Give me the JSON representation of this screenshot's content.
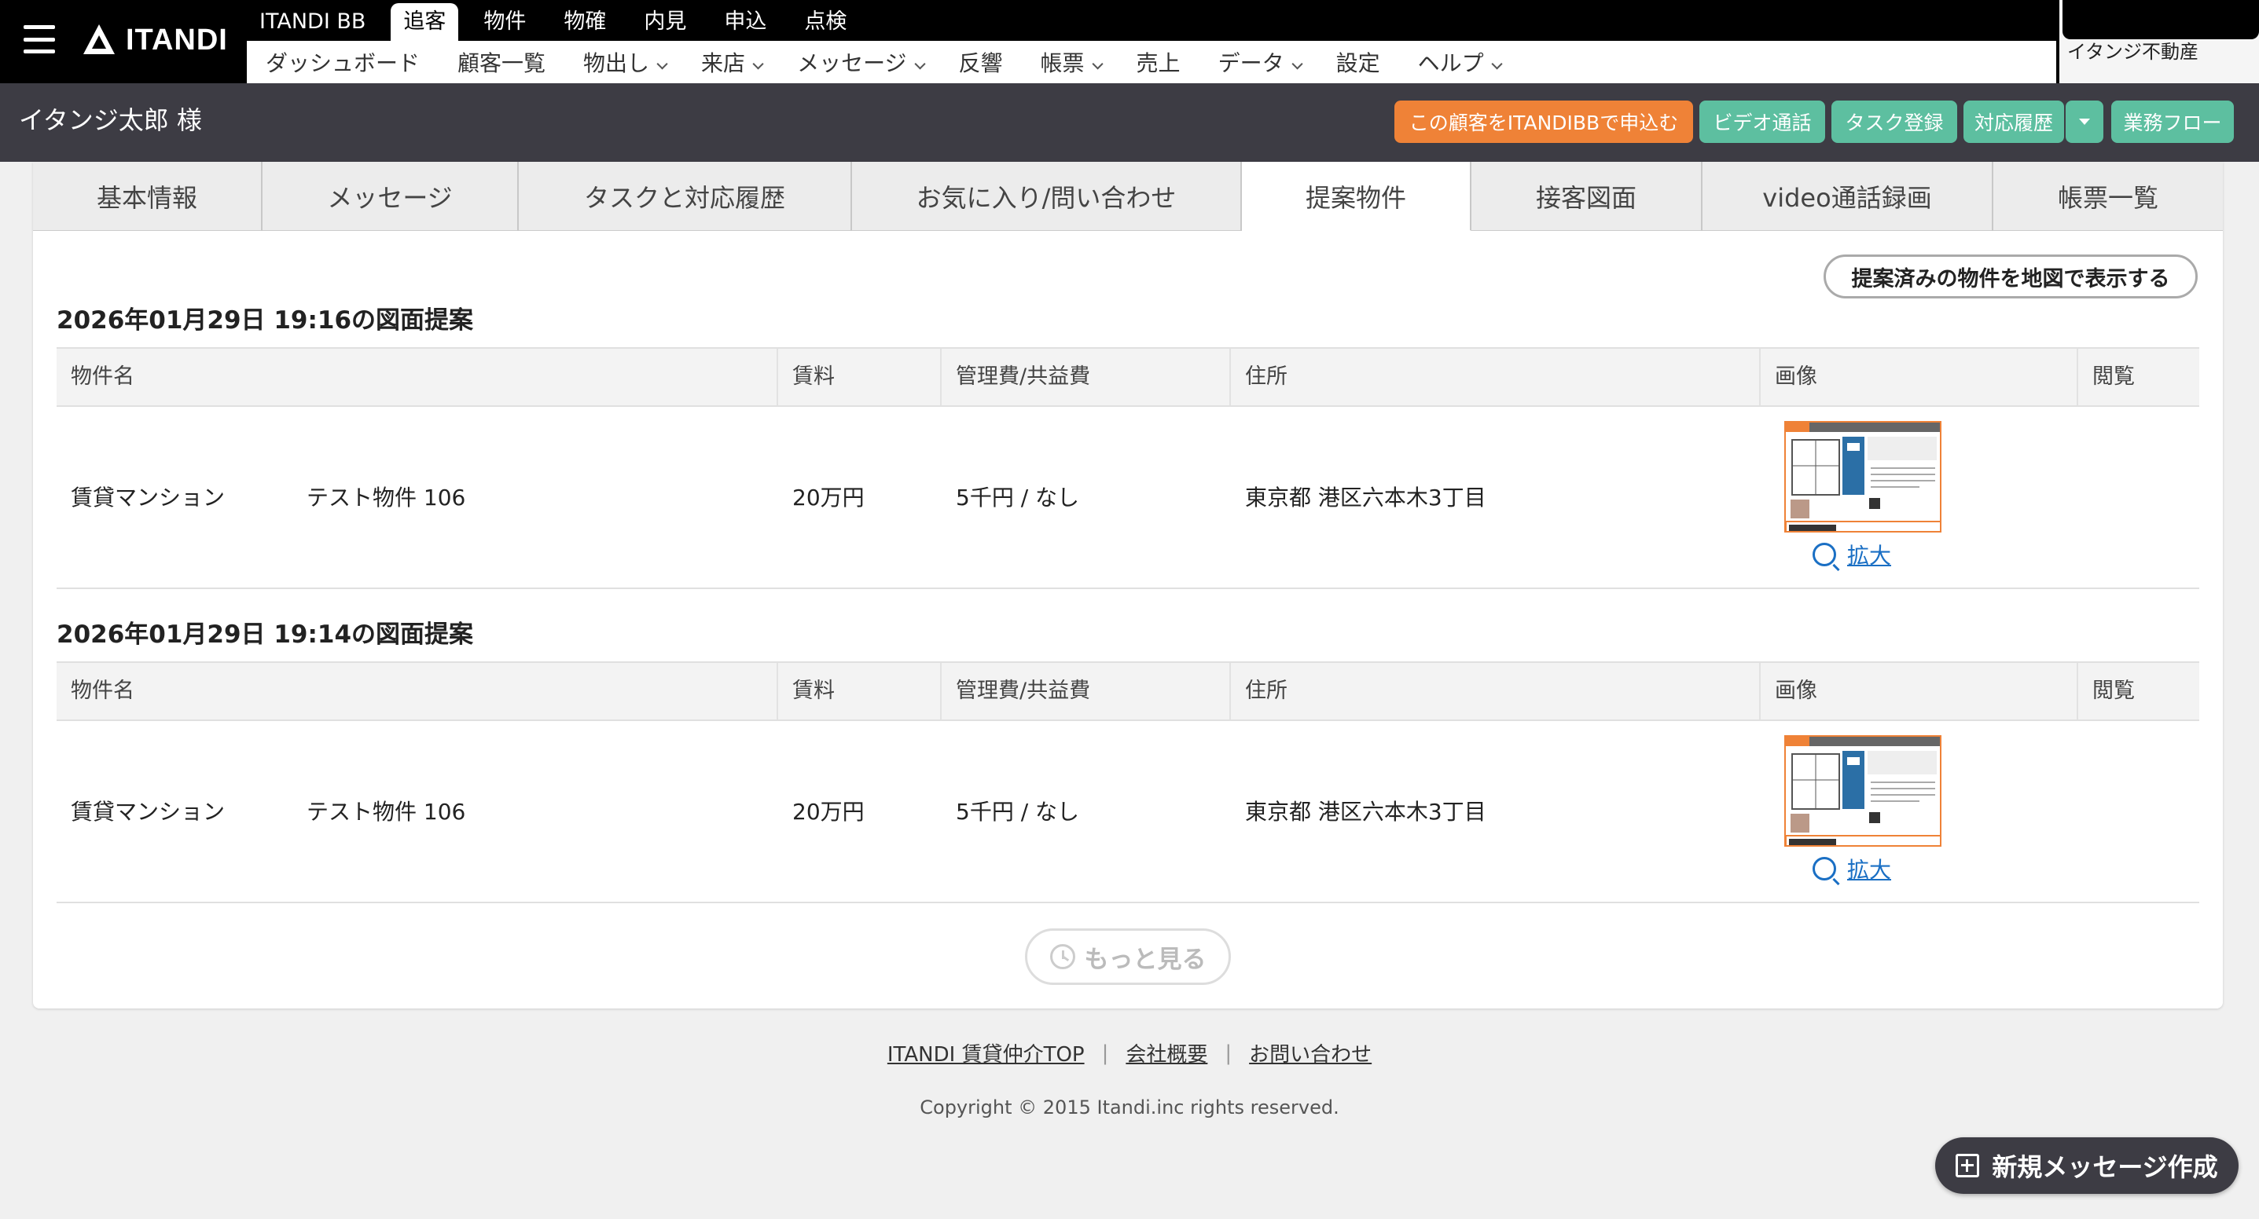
{
  "header": {
    "logo_text": "ITANDI",
    "top_nav": [
      {
        "label": "ITANDI BB",
        "active": false
      },
      {
        "label": "追客",
        "active": true
      },
      {
        "label": "物件",
        "active": false
      },
      {
        "label": "物確",
        "active": false
      },
      {
        "label": "内見",
        "active": false
      },
      {
        "label": "申込",
        "active": false
      },
      {
        "label": "点検",
        "active": false
      }
    ],
    "sub_nav": [
      {
        "label": "ダッシュボード",
        "dropdown": false
      },
      {
        "label": "顧客一覧",
        "dropdown": false
      },
      {
        "label": "物出し",
        "dropdown": true
      },
      {
        "label": "来店",
        "dropdown": true
      },
      {
        "label": "メッセージ",
        "dropdown": true
      },
      {
        "label": "反響",
        "dropdown": false
      },
      {
        "label": "帳票",
        "dropdown": true
      },
      {
        "label": "売上",
        "dropdown": false
      },
      {
        "label": "データ",
        "dropdown": true
      },
      {
        "label": "設定",
        "dropdown": false
      },
      {
        "label": "ヘルプ",
        "dropdown": true
      }
    ],
    "company": "イタンジ不動産"
  },
  "customer": {
    "name": "イタンジ太郎 様",
    "actions": {
      "apply": "この顧客をITANDIBBで申込む",
      "video_call": "ビデオ通話",
      "task_register": "タスク登録",
      "history": "対応履歴",
      "workflow": "業務フロー"
    }
  },
  "tabs": [
    {
      "label": "基本情報",
      "active": false
    },
    {
      "label": "メッセージ",
      "active": false
    },
    {
      "label": "タスクと対応履歴",
      "active": false
    },
    {
      "label": "お気に入り/問い合わせ",
      "active": false
    },
    {
      "label": "提案物件",
      "active": true
    },
    {
      "label": "接客図面",
      "active": false
    },
    {
      "label": "video通話録画",
      "active": false
    },
    {
      "label": "帳票一覧",
      "active": false
    }
  ],
  "map_button": "提案済みの物件を地図で表示する",
  "table_headers": [
    "物件名",
    "賃料",
    "管理費/共益費",
    "住所",
    "画像",
    "閲覧"
  ],
  "proposals": [
    {
      "title": "2026年01月29日 19:16の図面提案",
      "rows": [
        {
          "type": "賃貸マンション",
          "name": "テスト物件 106",
          "rent": "20万円",
          "fee": "5千円 / なし",
          "address": "東京都 港区六本木3丁目",
          "zoom_label": "拡大",
          "viewed": ""
        }
      ]
    },
    {
      "title": "2026年01月29日 19:14の図面提案",
      "rows": [
        {
          "type": "賃貸マンション",
          "name": "テスト物件 106",
          "rent": "20万円",
          "fee": "5千円 / なし",
          "address": "東京都 港区六本木3丁目",
          "zoom_label": "拡大",
          "viewed": ""
        }
      ]
    }
  ],
  "more_button": "もっと見る",
  "footer": {
    "links": [
      "ITANDI 賃貸仲介TOP",
      "会社概要",
      "お問い合わせ"
    ],
    "copyright": "Copyright © 2015 Itandi.inc rights reserved."
  },
  "new_message_button": "新規メッセージ作成",
  "colors": {
    "accent_orange": "#ef8237",
    "accent_green": "#5dbfa0",
    "header_dark": "#3d3c44",
    "link_blue": "#1a6fc4"
  },
  "icons": [
    "menu-icon",
    "itandi-logo-icon",
    "chevron-down-icon",
    "search-icon",
    "history-icon",
    "plus-square-icon",
    "caret-down-icon"
  ]
}
